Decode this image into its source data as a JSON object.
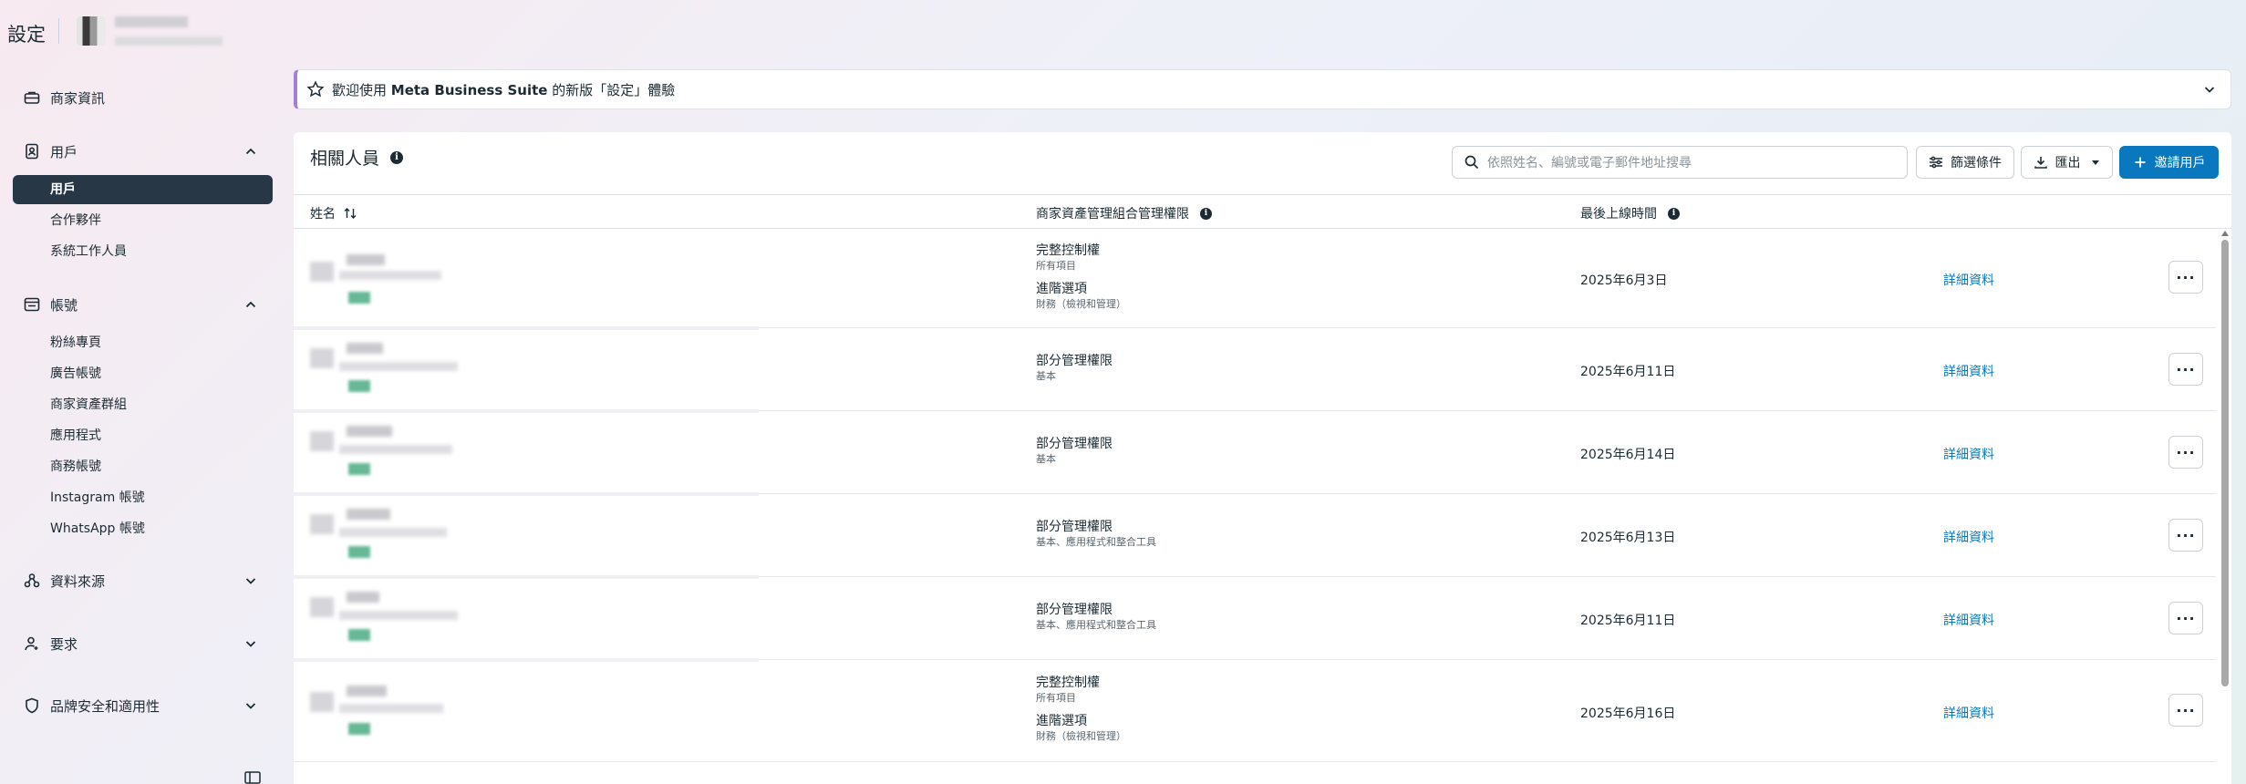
{
  "app": {
    "title": "設定"
  },
  "sidebar": {
    "sections": [
      {
        "label": "商家資訊",
        "icon": "briefcase-icon"
      },
      {
        "label": "用戶",
        "icon": "user-badge-icon",
        "expanded": true,
        "items": [
          {
            "label": "用戶",
            "active": true
          },
          {
            "label": "合作夥伴"
          },
          {
            "label": "系統工作人員"
          }
        ]
      },
      {
        "label": "帳號",
        "icon": "account-folder-icon",
        "expanded": true,
        "items": [
          {
            "label": "粉絲專頁"
          },
          {
            "label": "廣告帳號"
          },
          {
            "label": "商家資產群組"
          },
          {
            "label": "應用程式"
          },
          {
            "label": "商務帳號"
          },
          {
            "label": "Instagram 帳號"
          },
          {
            "label": "WhatsApp 帳號"
          }
        ]
      },
      {
        "label": "資料來源",
        "icon": "data-sources-icon",
        "expanded": false
      },
      {
        "label": "要求",
        "icon": "person-request-icon",
        "expanded": false
      },
      {
        "label": "品牌安全和適用性",
        "icon": "shield-icon",
        "expanded": false
      }
    ]
  },
  "banner": {
    "text_prefix": "歡迎使用 ",
    "text_bold": "Meta Business Suite",
    "text_suffix": " 的新版「設定」體驗"
  },
  "people": {
    "title": "相關人員",
    "search_placeholder": "依照姓名、編號或電子郵件地址搜尋",
    "filter_label": "篩選條件",
    "export_label": "匯出",
    "invite_label": "邀請用戶",
    "columns": {
      "name": "姓名",
      "permissions": "商家資產管理組合管理權限",
      "last_login": "最後上線時間"
    },
    "detail_label": "詳細資料",
    "rows": [
      {
        "perm1_title": "完整控制權",
        "perm1_sub": "所有項目",
        "perm2_title": "進階選項",
        "perm2_sub": "財務（檢視和管理）",
        "last_login": "2025年6月3日"
      },
      {
        "perm1_title": "部分管理權限",
        "perm1_sub": "基本",
        "last_login": "2025年6月11日"
      },
      {
        "perm1_title": "部分管理權限",
        "perm1_sub": "基本",
        "last_login": "2025年6月14日"
      },
      {
        "perm1_title": "部分管理權限",
        "perm1_sub": "基本、應用程式和整合工具",
        "last_login": "2025年6月13日"
      },
      {
        "perm1_title": "部分管理權限",
        "perm1_sub": "基本、應用程式和整合工具",
        "last_login": "2025年6月11日"
      },
      {
        "perm1_title": "完整控制權",
        "perm1_sub": "所有項目",
        "perm2_title": "進階選項",
        "perm2_sub": "財務（檢視和管理）",
        "last_login": "2025年6月16日"
      }
    ]
  },
  "colors": {
    "accent": "#0a78be",
    "active_nav": "#283745",
    "banner_border": "#a47fd6"
  }
}
